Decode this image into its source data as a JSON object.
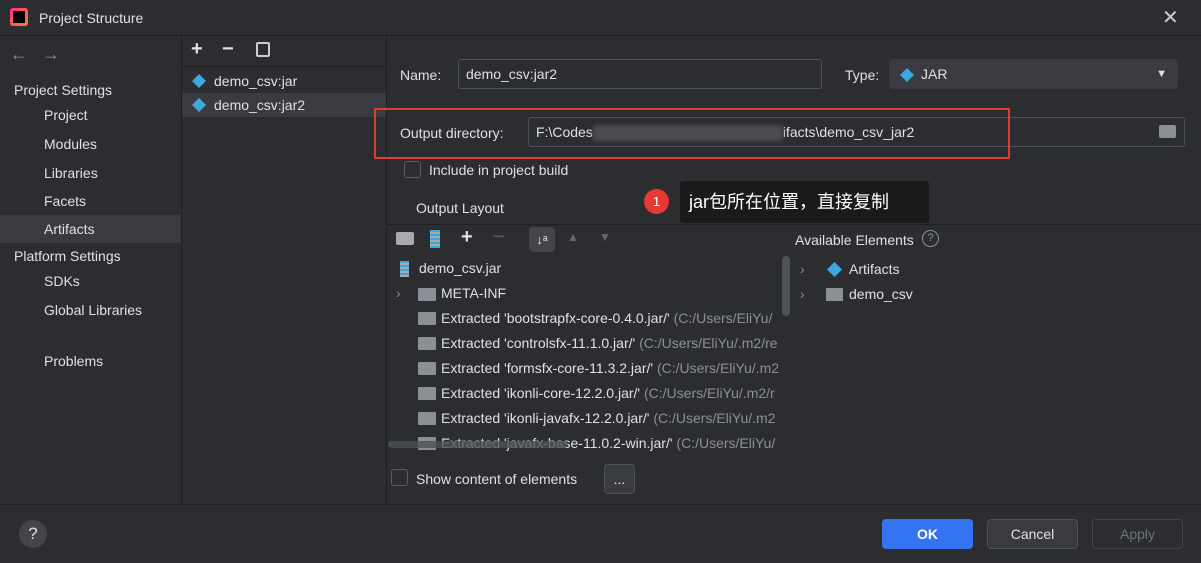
{
  "window": {
    "title": "Project Structure"
  },
  "sidebar": {
    "project_settings": "Project Settings",
    "items": [
      "Project",
      "Modules",
      "Libraries",
      "Facets",
      "Artifacts"
    ],
    "platform_settings": "Platform Settings",
    "platform_items": [
      "SDKs",
      "Global Libraries"
    ],
    "problems": "Problems",
    "selected": "Artifacts"
  },
  "artifacts": {
    "items": [
      "demo_csv:jar",
      "demo_csv:jar2"
    ],
    "selected": "demo_csv:jar2"
  },
  "form": {
    "name_label": "Name:",
    "name_value": "demo_csv:jar2",
    "type_label": "Type:",
    "type_value": "JAR",
    "output_label": "Output directory:",
    "output_prefix": "F:\\Codes",
    "output_suffix": "ifacts\\demo_csv_jar2",
    "include_label": "Include in project build",
    "include_checked": false,
    "output_layout": "Output Layout"
  },
  "annotation": {
    "number": "1",
    "text": "jar包所在位置，直接复制",
    "color": "#e53935"
  },
  "layout_tree": {
    "root": "demo_csv.jar",
    "folder": "META-INF",
    "entries": [
      {
        "name": "Extracted 'bootstrapfx-core-0.4.0.jar/'",
        "path": "(C:/Users/EliYu/"
      },
      {
        "name": "Extracted 'controlsfx-11.1.0.jar/'",
        "path": "(C:/Users/EliYu/.m2/re"
      },
      {
        "name": "Extracted 'formsfx-core-11.3.2.jar/'",
        "path": "(C:/Users/EliYu/.m2"
      },
      {
        "name": "Extracted 'ikonli-core-12.2.0.jar/'",
        "path": "(C:/Users/EliYu/.m2/r"
      },
      {
        "name": "Extracted 'ikonli-javafx-12.2.0.jar/'",
        "path": "(C:/Users/EliYu/.m2"
      },
      {
        "name": "Extracted 'javafx-base-11.0.2-win.jar/'",
        "path": "(C:/Users/EliYu/"
      }
    ]
  },
  "available": {
    "title": "Available Elements",
    "items": [
      "Artifacts",
      "demo_csv"
    ]
  },
  "show_content": {
    "label": "Show content of elements",
    "checked": false,
    "more": "..."
  },
  "buttons": {
    "ok": "OK",
    "cancel": "Cancel",
    "apply": "Apply",
    "help": "?"
  },
  "colors": {
    "accent": "#3574f0",
    "jar_icon": "#3ea8de"
  }
}
